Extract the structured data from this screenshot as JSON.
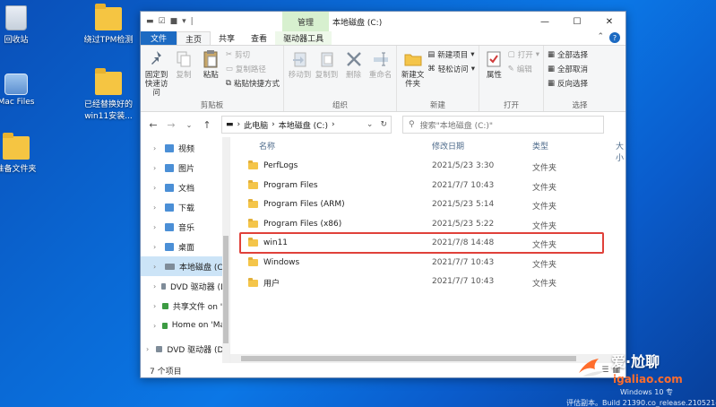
{
  "desktop": {
    "icons": [
      {
        "label": "回收站"
      },
      {
        "label": "Mac Files"
      },
      {
        "label": "准备文件夹"
      },
      {
        "label": "绕过TPM检测"
      },
      {
        "label": "已经替换好的win11安装..."
      }
    ]
  },
  "window": {
    "context_tab": "管理",
    "title": "本地磁盘 (C:)",
    "controls": {
      "minimize": "—",
      "maximize": "☐",
      "close": "✕"
    },
    "ribbon_tabs": [
      "文件",
      "主页",
      "共享",
      "查看",
      "驱动器工具"
    ],
    "ribbon": {
      "clipboard": {
        "label": "剪贴板",
        "pin": "固定到快速访问",
        "copy": "复制",
        "paste": "粘贴",
        "cut": "剪切",
        "copy_path": "复制路径",
        "paste_shortcut": "粘贴快捷方式"
      },
      "organize": {
        "label": "组织",
        "move_to": "移动到",
        "copy_to": "复制到",
        "delete": "删除",
        "rename": "重命名"
      },
      "new": {
        "label": "新建",
        "new_folder": "新建文件夹",
        "new_item": "新建项目",
        "easy_access": "轻松访问"
      },
      "open": {
        "label": "打开",
        "properties": "属性",
        "open": "打开",
        "edit": "编辑"
      },
      "select": {
        "label": "选择",
        "select_all": "全部选择",
        "select_none": "全部取消",
        "invert": "反向选择"
      }
    },
    "address": {
      "segments": [
        "此电脑",
        "本地磁盘 (C:)"
      ]
    },
    "search": {
      "placeholder": "搜索\"本地磁盘 (C:)\""
    },
    "nav_pane": [
      {
        "label": "视频",
        "kind": "folder"
      },
      {
        "label": "图片",
        "kind": "folder"
      },
      {
        "label": "文档",
        "kind": "folder"
      },
      {
        "label": "下载",
        "kind": "folder"
      },
      {
        "label": "音乐",
        "kind": "folder"
      },
      {
        "label": "桌面",
        "kind": "folder"
      },
      {
        "label": "本地磁盘 (C:)",
        "kind": "drive",
        "selected": true
      },
      {
        "label": "DVD 驱动器 (D:",
        "kind": "drive"
      },
      {
        "label": "共享文件 on 'M",
        "kind": "net"
      },
      {
        "label": "Home on 'Mac",
        "kind": "net"
      },
      {
        "label": "DVD 驱动器 (D:)",
        "kind": "drive"
      }
    ],
    "columns": {
      "name": "名称",
      "date": "修改日期",
      "type": "类型",
      "size": "大小"
    },
    "files": [
      {
        "name": "PerfLogs",
        "date": "2021/5/23 3:30",
        "type": "文件夹"
      },
      {
        "name": "Program Files",
        "date": "2021/7/7 10:43",
        "type": "文件夹"
      },
      {
        "name": "Program Files (ARM)",
        "date": "2021/5/23 5:14",
        "type": "文件夹"
      },
      {
        "name": "Program Files (x86)",
        "date": "2021/5/23 5:22",
        "type": "文件夹"
      },
      {
        "name": "win11",
        "date": "2021/7/8 14:48",
        "type": "文件夹",
        "highlighted": true
      },
      {
        "name": "Windows",
        "date": "2021/7/7 10:43",
        "type": "文件夹"
      },
      {
        "name": "用户",
        "date": "2021/7/7 10:43",
        "type": "文件夹"
      }
    ],
    "status": "7 个项目",
    "highlight_color": "#e0413a"
  },
  "watermark": {
    "text": "爱·尬聊",
    "url": "igaliao.com",
    "build_line1": "Windows 10 专",
    "build_line2": "评估副本。Build 21390.co_release.210521-"
  }
}
